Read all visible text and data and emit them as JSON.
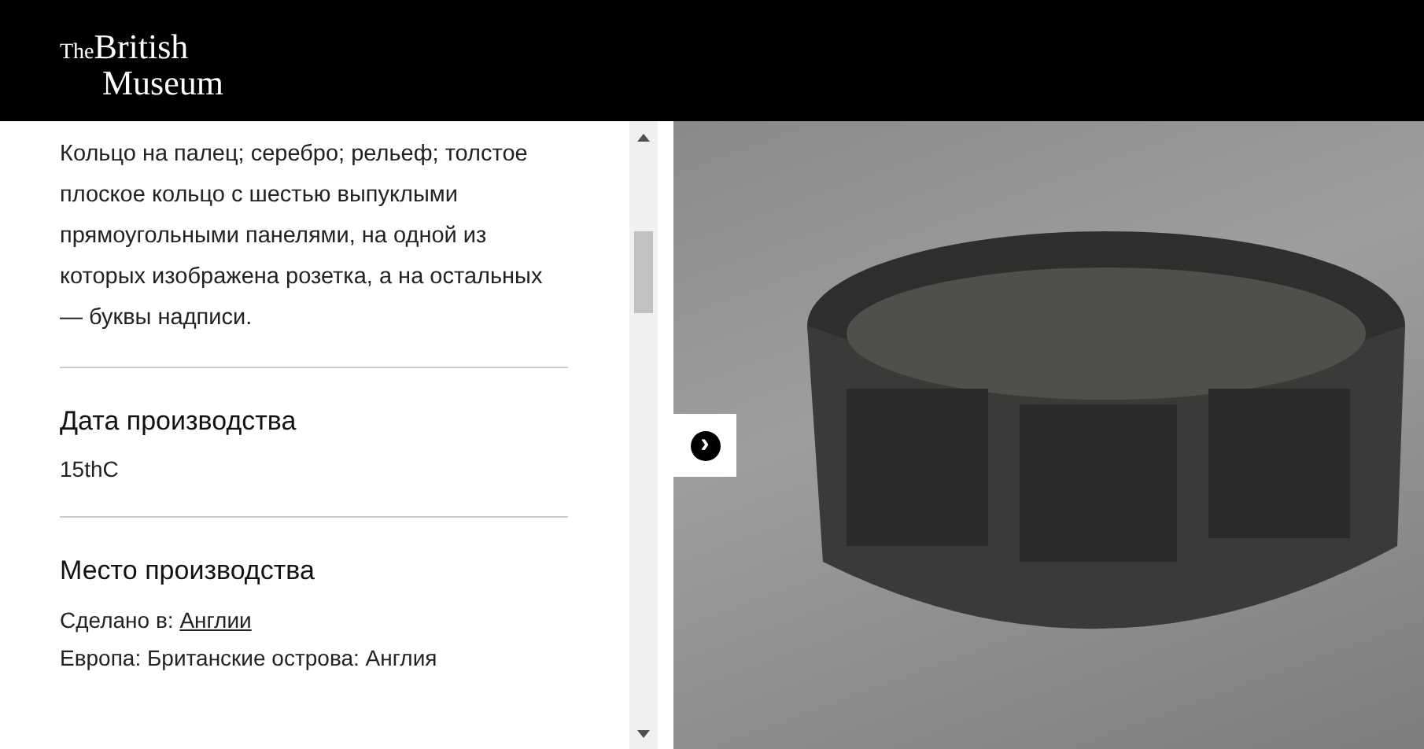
{
  "header": {
    "logo": {
      "small": "The",
      "line_1": "British",
      "line_2": "Museum"
    }
  },
  "description": "Кольцо на палец; серебро; рельеф; толстое плоское кольцо с шестью выпуклыми прямоугольными панелями, на одной из которых изображена розетка, а на остальных — буквы надписи.",
  "sections": [
    {
      "heading": "Дата производства",
      "lines": [
        {
          "text": "15thC"
        }
      ]
    },
    {
      "heading": "Место производства",
      "lines": [
        {
          "text": "Сделано в: ",
          "link": "Англии"
        },
        {
          "text": "Европа: Британские острова: Англия"
        }
      ]
    }
  ],
  "viewer": {
    "next_button": "›"
  }
}
